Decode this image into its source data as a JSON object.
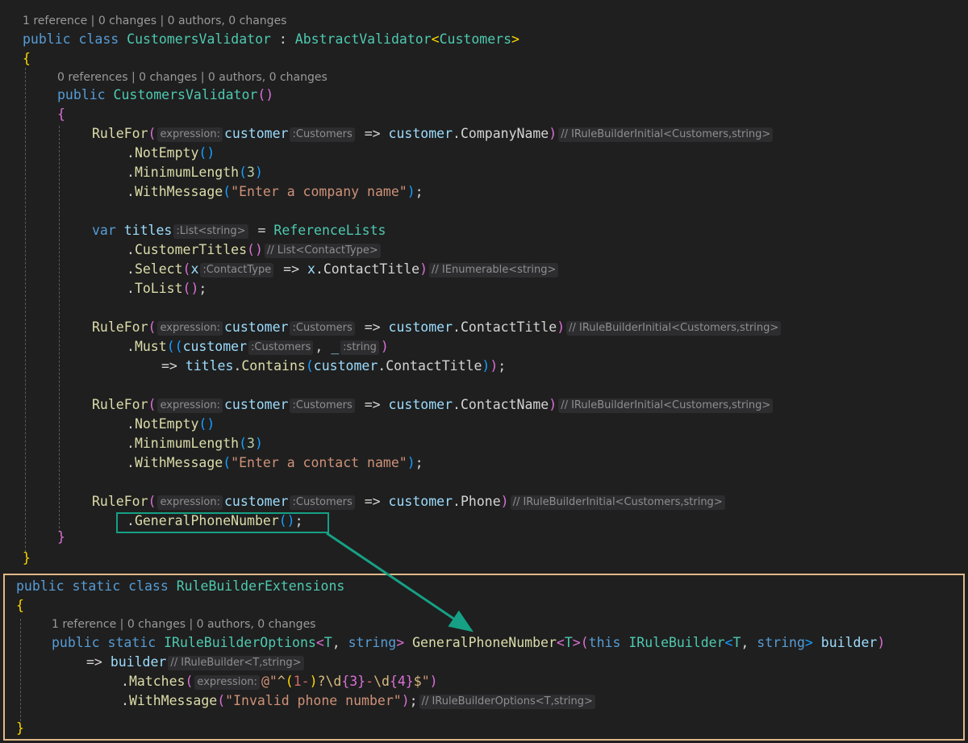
{
  "lenses": {
    "class_lens": "1 reference | 0 changes | 0 authors, 0 changes",
    "ctor_lens": "0 references | 0 changes | 0 authors, 0 changes",
    "ext_lens": "1 reference | 0 changes | 0 authors, 0 changes"
  },
  "tok": {
    "public": "public",
    "class": "class",
    "static": "static",
    "var": "var",
    "this": "this",
    "string": "string",
    "CustomersValidator": "CustomersValidator",
    "AbstractValidator": "AbstractValidator",
    "Customers": "Customers",
    "RuleFor": "RuleFor",
    "customer": "customer",
    "CompanyName": "CompanyName",
    "NotEmpty": "NotEmpty",
    "MinimumLength": "MinimumLength",
    "WithMessage": "WithMessage",
    "msg_company": "\"Enter a company name\"",
    "msg_contact": "\"Enter a contact name\"",
    "msg_phone": "\"Invalid phone number\"",
    "num3": "3",
    "titles": "titles",
    "ReferenceLists": "ReferenceLists",
    "CustomerTitles": "CustomerTitles",
    "Select": "Select",
    "x": "x",
    "ContactTitle": "ContactTitle",
    "ToList": "ToList",
    "Must": "Must",
    "underscore": "_",
    "Contains": "Contains",
    "ContactName": "ContactName",
    "Phone": "Phone",
    "GeneralPhoneNumber": "GeneralPhoneNumber",
    "RuleBuilderExtensions": "RuleBuilderExtensions",
    "IRuleBuilderOptions": "IRuleBuilderOptions",
    "IRuleBuilder": "IRuleBuilder",
    "T": "T",
    "builder": "builder",
    "Matches": "Matches",
    "regex_at": "@\"",
    "regex_caret": "^",
    "regex_open": "(",
    "regex_1": "1-",
    "regex_close": ")",
    "regex_q": "?",
    "regex_d": "\\d",
    "regex_q3": "{3}",
    "regex_dash": "-",
    "regex_q4": "{4}",
    "regex_dollar": "$",
    "regex_end": "\""
  },
  "hints": {
    "expression": "expression:",
    "customers_type": ":Customers",
    "list_string": ":List<string>",
    "contact_type": ":ContactType",
    "string_type": ":string",
    "irule_initial": "// IRuleBuilderInitial<Customers,string>",
    "list_contact": "// List<ContactType>",
    "ienumerable": "// IEnumerable<string>",
    "irule_builder_t": "// IRuleBuilder<T,string>",
    "irule_options_t": "// IRuleBuilderOptions<T,string>"
  },
  "colors": {
    "background": "#1f1f1f",
    "keyword": "#569cd6",
    "type": "#4ec9b0",
    "method": "#dcdcaa",
    "identifier": "#9cdcfe",
    "string": "#ce9178",
    "number": "#b5cea8",
    "highlight_box": "#16a085",
    "panel_border": "#e0b888"
  }
}
